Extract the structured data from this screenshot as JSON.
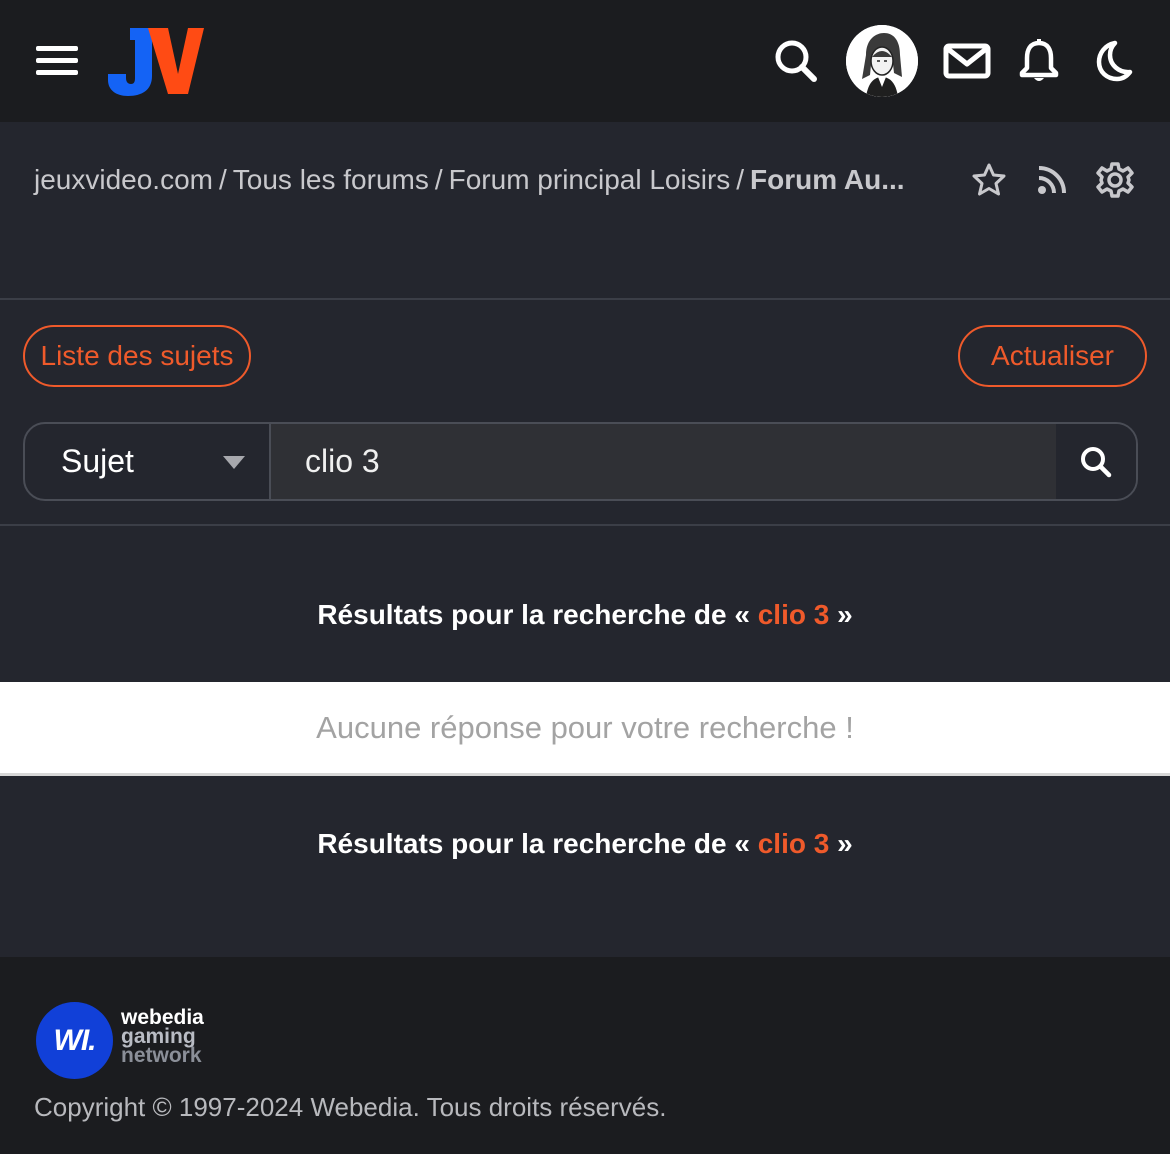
{
  "header": {
    "menu_icon": "hamburger-menu-icon",
    "logo_text": "JV",
    "icons": [
      "search-icon",
      "avatar",
      "mail-icon",
      "bell-icon",
      "moon-icon"
    ]
  },
  "breadcrumb": {
    "items": [
      "jeuxvideo.com",
      "Tous les forums",
      "Forum principal Loisirs"
    ],
    "current": "Forum Au...",
    "separator": "/",
    "actions": [
      "star-icon",
      "rss-icon",
      "settings-icon"
    ]
  },
  "controls": {
    "topics_button": "Liste des sujets",
    "refresh_button": "Actualiser",
    "search_scope": "Sujet",
    "search_value": "clio 3"
  },
  "results": {
    "title_prefix": "Résultats pour la recherche de « ",
    "term": "clio 3",
    "title_suffix": " »",
    "empty_message": "Aucune réponse pour votre recherche !"
  },
  "footer": {
    "network_badge": "WI.",
    "network_line1": "webedia",
    "network_line2": "gaming",
    "network_line3": "network",
    "copyright": "Copyright © 1997-2024 Webedia. Tous droits réservés."
  },
  "colors": {
    "accent": "#ef5a2b",
    "background": "#24262e",
    "header": "#1b1c1f",
    "webedia_blue": "#1140d8"
  }
}
